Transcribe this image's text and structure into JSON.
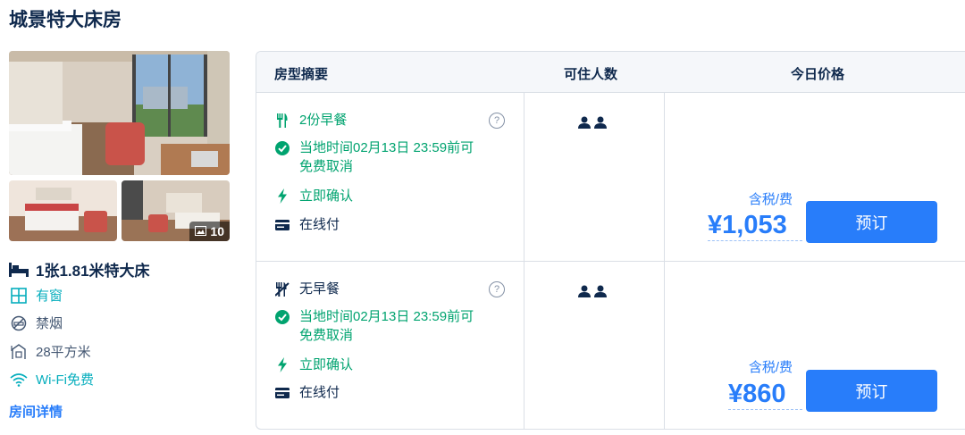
{
  "room": {
    "title": "城景特大床房",
    "photo_count": "10",
    "bed": "1张1.81米特大床",
    "amenities": [
      {
        "label": "有窗",
        "icon": "window-icon",
        "color": "#06aebd"
      },
      {
        "label": "禁烟",
        "icon": "no-smoking-icon",
        "color": "#455873"
      },
      {
        "label": "28平方米",
        "icon": "area-icon",
        "color": "#455873"
      },
      {
        "label": "Wi-Fi免费",
        "icon": "wifi-icon",
        "color": "#06aebd"
      }
    ],
    "details_link": "房间详情"
  },
  "table": {
    "headers": [
      "房型摘要",
      "可住人数",
      "今日价格"
    ]
  },
  "offers": [
    {
      "meal": "2份早餐",
      "meal_icon": "utensils-icon",
      "cancel": "当地时间02月13日 23:59前可",
      "cancel_line2": "免费取消",
      "confirm": "立即确认",
      "payment": "在线付",
      "guests": 2,
      "tax_label": "含税/费",
      "price": "¥1,053",
      "book_label": "预订"
    },
    {
      "meal": "无早餐",
      "meal_icon": "no-meal-icon",
      "cancel": "当地时间02月13日 23:59前可",
      "cancel_line2": "免费取消",
      "confirm": "立即确认",
      "payment": "在线付",
      "guests": 2,
      "tax_label": "含税/费",
      "price": "¥860",
      "book_label": "预订"
    }
  ],
  "colors": {
    "accent": "#287dfa",
    "green": "#00a36f",
    "teal": "#06aebd",
    "text": "#0f294d"
  }
}
